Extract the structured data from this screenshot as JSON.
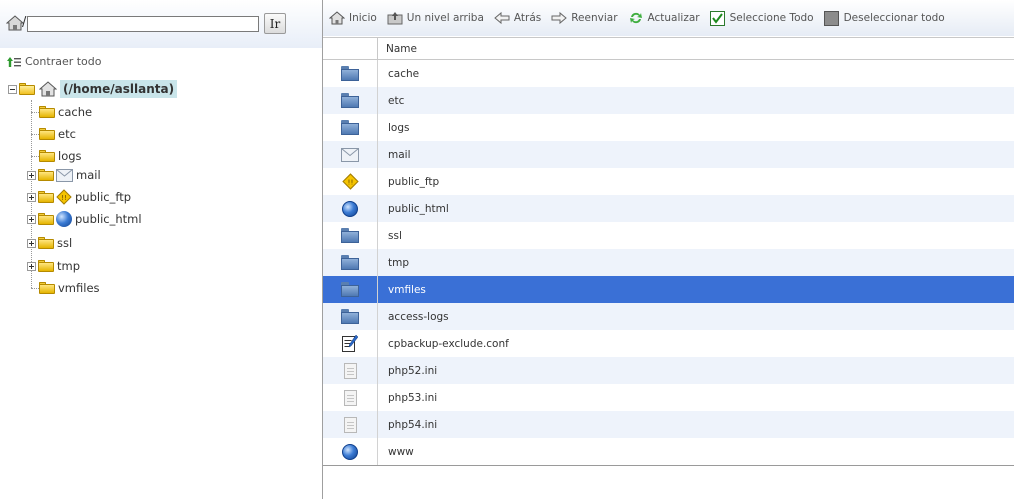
{
  "path_bar": {
    "slash": "/",
    "path_value": "",
    "go_label": "Ir"
  },
  "tree": {
    "collapse_label": "Contraer todo",
    "root_label": "(/home/asllanta)",
    "nodes": [
      {
        "label": "cache",
        "expandable": false
      },
      {
        "label": "etc",
        "expandable": false
      },
      {
        "label": "logs",
        "expandable": false
      },
      {
        "label": "mail",
        "expandable": true
      },
      {
        "label": "public_ftp",
        "expandable": true
      },
      {
        "label": "public_html",
        "expandable": true
      },
      {
        "label": "ssl",
        "expandable": true
      },
      {
        "label": "tmp",
        "expandable": true
      },
      {
        "label": "vmfiles",
        "expandable": false
      }
    ]
  },
  "toolbar": {
    "home": "Inicio",
    "up": "Un nivel arriba",
    "back": "Atrás",
    "forward": "Reenviar",
    "refresh": "Actualizar",
    "select_all": "Seleccione Todo",
    "deselect_all": "Deseleccionar todo"
  },
  "files": {
    "header_name": "Name",
    "selected_index": 8,
    "rows": [
      {
        "name": "cache",
        "icon": "folder-icon"
      },
      {
        "name": "etc",
        "icon": "folder-icon"
      },
      {
        "name": "logs",
        "icon": "folder-icon"
      },
      {
        "name": "mail",
        "icon": "mail-icon"
      },
      {
        "name": "public_ftp",
        "icon": "ftp-icon"
      },
      {
        "name": "public_html",
        "icon": "globe-icon"
      },
      {
        "name": "ssl",
        "icon": "folder-icon"
      },
      {
        "name": "tmp",
        "icon": "folder-icon"
      },
      {
        "name": "vmfiles",
        "icon": "folder-icon"
      },
      {
        "name": "access-logs",
        "icon": "folder-icon"
      },
      {
        "name": "cpbackup-exclude.conf",
        "icon": "config-file-icon"
      },
      {
        "name": "php52.ini",
        "icon": "text-file-icon"
      },
      {
        "name": "php53.ini",
        "icon": "text-file-icon"
      },
      {
        "name": "php54.ini",
        "icon": "text-file-icon"
      },
      {
        "name": "www",
        "icon": "globe-icon"
      }
    ]
  },
  "colors": {
    "selected_row": "#3a70d6",
    "alt_row": "#eef3fb",
    "root_highlight": "#c9e5ea"
  }
}
